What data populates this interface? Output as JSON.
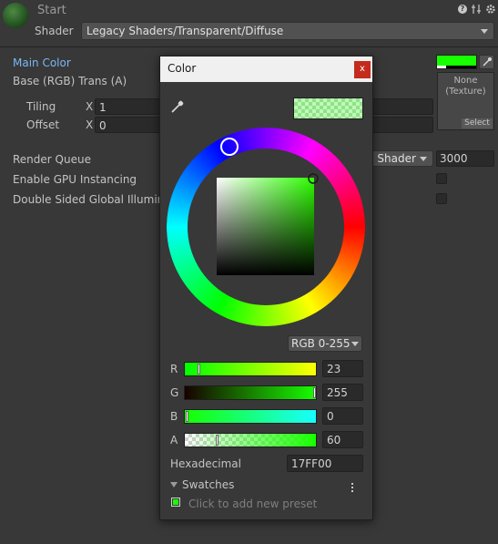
{
  "header": {
    "title": "Start",
    "shader_label": "Shader",
    "shader_value": "Legacy Shaders/Transparent/Diffuse"
  },
  "material": {
    "main_color_label": "Main Color",
    "main_color_hex": "#17FF00",
    "base_label": "Base (RGB) Trans (A)",
    "tiling_label": "Tiling",
    "offset_label": "Offset",
    "tiling_x_axis": "X",
    "tiling_x": "1",
    "offset_x_axis": "X",
    "offset_x": "0",
    "texture_none": "None",
    "texture_type": "(Texture)",
    "texture_select": "Select",
    "render_queue_label": "Render Queue",
    "render_queue_mode": "n Shader",
    "render_queue_value": "3000",
    "gpu_instancing_label": "Enable GPU Instancing",
    "double_sided_label": "Double Sided Global Illumina"
  },
  "color_picker": {
    "title": "Color",
    "close_glyph": "x",
    "mode": "RGB 0-255",
    "channels": [
      {
        "label": "R",
        "value": "23",
        "fraction": 0.09
      },
      {
        "label": "G",
        "value": "255",
        "fraction": 1.0
      },
      {
        "label": "B",
        "value": "0",
        "fraction": 0.0
      },
      {
        "label": "A",
        "value": "60",
        "fraction": 0.235
      }
    ],
    "hex_label": "Hexadecimal",
    "hex_value": "17FF00",
    "swatches_label": "Swatches",
    "add_preset": "Click to add new preset"
  },
  "icons": {
    "eyedropper": "eyedropper-icon",
    "help": "?",
    "settings": "gear-icon"
  },
  "colors": {
    "accent_blue": "#7bb7f5",
    "selected_color": "#17FF00"
  }
}
